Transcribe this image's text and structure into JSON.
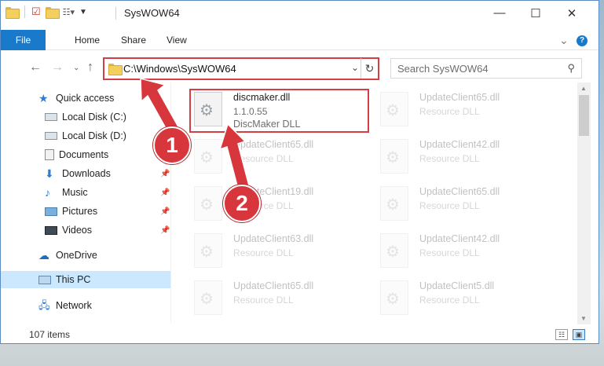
{
  "window": {
    "title": "SysWOW64",
    "controls": {
      "minimize": "—",
      "maximize": "☐",
      "close": "✕"
    }
  },
  "ribbon": {
    "tabs": [
      "File",
      "Home",
      "Share",
      "View"
    ],
    "expand_glyph": "⌄",
    "help_glyph": "?"
  },
  "address": {
    "path": "C:\\Windows\\SysWOW64",
    "refresh_glyph": "↻",
    "dropdown_glyph": "⌄",
    "accent_color": "#d63d44"
  },
  "search": {
    "placeholder": "Search SysWOW64"
  },
  "sidebar": {
    "items": [
      {
        "label": "Quick access"
      },
      {
        "label": "Local Disk (C:)"
      },
      {
        "label": "Local Disk (D:)"
      },
      {
        "label": "Documents"
      },
      {
        "label": "Downloads"
      },
      {
        "label": "Music"
      },
      {
        "label": "Pictures"
      },
      {
        "label": "Videos"
      },
      {
        "label": "OneDrive"
      },
      {
        "label": "This PC"
      },
      {
        "label": "Network"
      }
    ]
  },
  "files": {
    "highlighted": {
      "name": "discmaker.dll",
      "version": "1.1.0.55",
      "description": "DiscMaker DLL"
    },
    "left_column": [
      {
        "name": "UpdateClient65.dll",
        "type": "Resource DLL"
      },
      {
        "name": "UpdateClient19.dll",
        "type": "Resource DLL"
      },
      {
        "name": "UpdateClient63.dll",
        "type": "Resource DLL"
      },
      {
        "name": "UpdateClient65.dll",
        "type": "Resource DLL"
      }
    ],
    "right_column": [
      {
        "name": "UpdateClient65.dll",
        "type": "Resource DLL"
      },
      {
        "name": "UpdateClient42.dll",
        "type": "Resource DLL"
      },
      {
        "name": "UpdateClient65.dll",
        "type": "Resource DLL"
      },
      {
        "name": "UpdateClient42.dll",
        "type": "Resource DLL"
      },
      {
        "name": "UpdateClient5.dll",
        "type": "Resource DLL"
      }
    ]
  },
  "status": {
    "item_count": "107 items"
  },
  "annotations": {
    "step1": "1",
    "step2": "2",
    "color": "#d8363d"
  }
}
